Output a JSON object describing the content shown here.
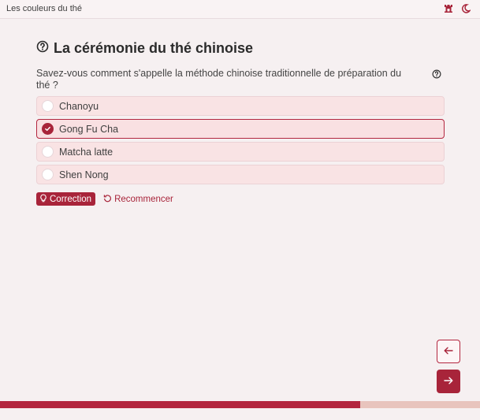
{
  "header": {
    "site_title": "Les couleurs du thé",
    "icons": [
      "castle-icon",
      "moon-icon"
    ]
  },
  "page": {
    "title": "La cérémonie du thé chinoise",
    "title_icon": "question-circle-icon"
  },
  "question": {
    "text": "Savez-vous comment s'appelle la méthode chinoise traditionnelle de préparation du thé ?",
    "help_icon": "question-circle-icon"
  },
  "options": [
    {
      "label": "Chanoyu",
      "selected": false
    },
    {
      "label": "Gong Fu Cha",
      "selected": true
    },
    {
      "label": "Matcha latte",
      "selected": false
    },
    {
      "label": "Shen Nong",
      "selected": false
    }
  ],
  "actions": {
    "correction_label": "Correction",
    "reset_label": "Recommencer"
  },
  "navigation": {
    "prev_icon": "arrow-left-icon",
    "next_icon": "arrow-right-icon"
  },
  "progress": {
    "fraction": 0.75
  },
  "colors": {
    "accent": "#a8243a",
    "option_bg": "#f9e3e4",
    "progress_track": "#e8c4bd",
    "page_bg": "#f6f0f1"
  }
}
